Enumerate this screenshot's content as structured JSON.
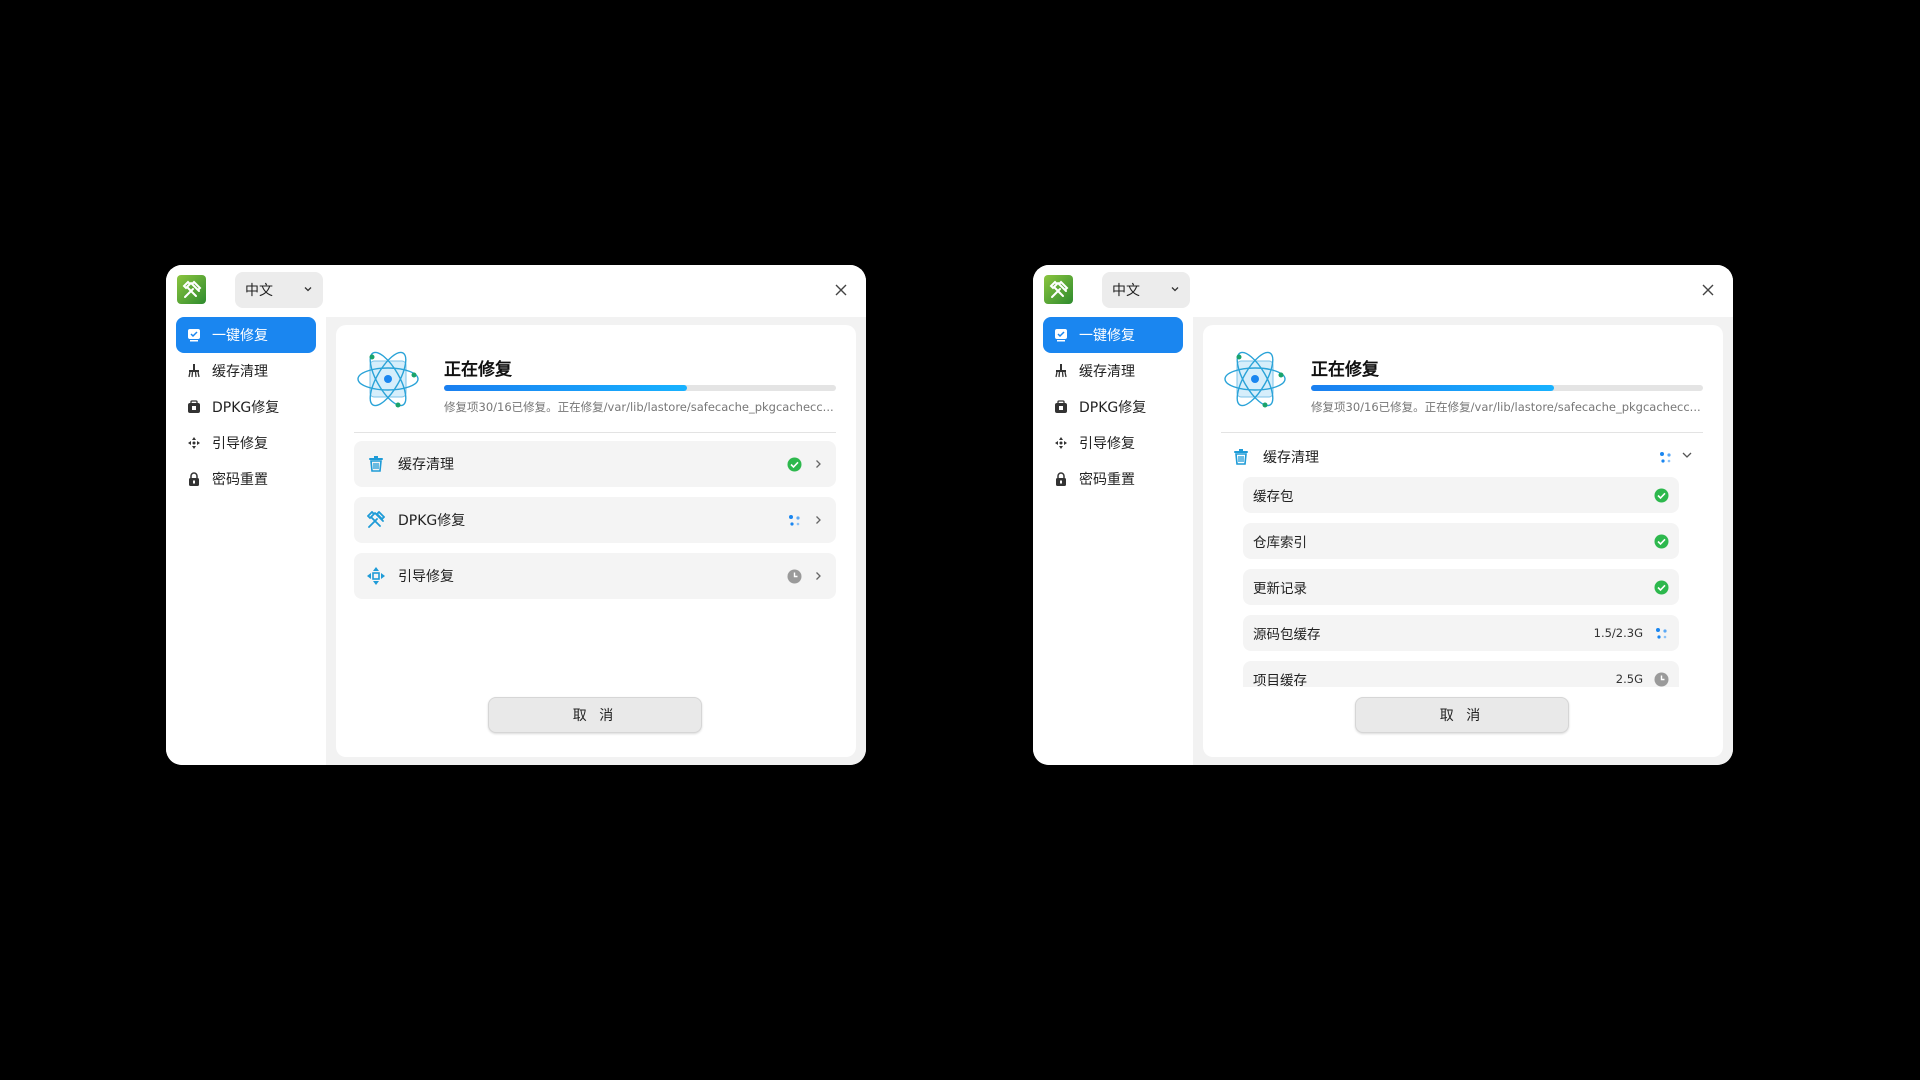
{
  "app": {
    "language": "中文"
  },
  "nav": {
    "items": [
      {
        "label": "一键修复",
        "icon": "one-click-repair-icon",
        "active": true
      },
      {
        "label": "缓存清理",
        "icon": "broom-icon"
      },
      {
        "label": "DPKG修复",
        "icon": "package-icon"
      },
      {
        "label": "引导修复",
        "icon": "boot-icon"
      },
      {
        "label": "密码重置",
        "icon": "lock-icon"
      }
    ]
  },
  "repair": {
    "title": "正在修复",
    "progress": 0.62,
    "status_text": "修复项30/16已修复。正在修复/var/lib/lastore/safecache_pkgcachecc...",
    "cancel_label": "取 消"
  },
  "left_tasks": [
    {
      "label": "缓存清理",
      "icon": "trash-icon",
      "status": "done"
    },
    {
      "label": "DPKG修复",
      "icon": "tools-icon",
      "status": "running"
    },
    {
      "label": "引导修复",
      "icon": "boot-icon",
      "status": "pending"
    }
  ],
  "right_group": {
    "label": "缓存清理",
    "icon": "trash-icon",
    "status": "running",
    "items": [
      {
        "label": "缓存包",
        "size": "",
        "status": "done"
      },
      {
        "label": "仓库索引",
        "size": "",
        "status": "done"
      },
      {
        "label": "更新记录",
        "size": "",
        "status": "done"
      },
      {
        "label": "源码包缓存",
        "size": "1.5/2.3G",
        "status": "running"
      },
      {
        "label": "项目缓存",
        "size": "2.5G",
        "status": "pending"
      }
    ]
  },
  "colors": {
    "accent": "#1a86f0",
    "success": "#2db84d",
    "pending": "#9a9a9a",
    "icon_teal": "#1e9bd7"
  }
}
